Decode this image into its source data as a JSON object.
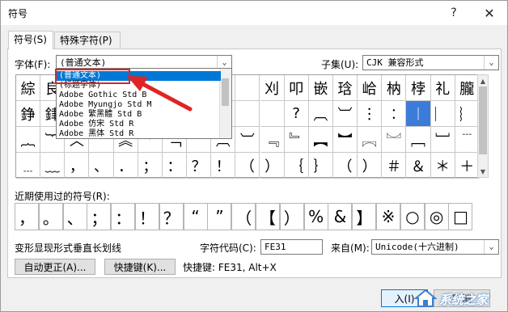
{
  "window": {
    "title": "符号",
    "help": "?",
    "close": "✕"
  },
  "tabs": [
    {
      "label": "符号(S)"
    },
    {
      "label": "特殊字符(P)"
    }
  ],
  "font": {
    "label": "字体(F):",
    "value": "(普通文本)"
  },
  "subset": {
    "label": "子集(U):",
    "value": "CJK 兼容形式"
  },
  "grid": {
    "rows": [
      [
        "綜",
        "良",
        "",
        "",
        "",
        "",
        "",
        "",
        "",
        "",
        "刈",
        "叩",
        "嵌",
        "琀",
        "峆",
        "枘",
        "桲",
        "礼",
        "朧",
        "蘊",
        "蛀",
        "赳",
        "逡"
      ],
      [
        "錚",
        "銉",
        "",
        "",
        "",
        "",
        "",
        "",
        "",
        "",
        "",
        "?",
        "︹",
        "︺",
        "︙",
        "︰",
        "︱",
        "︳",
        "︴",
        "",
        "︵"
      ],
      [
        "︷",
        "︸",
        "︿",
        "﹀",
        "︽",
        "︾",
        "﹁",
        "﹂",
        "︹",
        "︺",
        "﹃",
        "﹄",
        "︻",
        "︼",
        "︗",
        "︘",
        "﹇",
        "﹈",
        "﹉",
        "﹊",
        "﹋",
        "﹌"
      ],
      [
        "﹍",
        "﹏",
        "，",
        "、",
        "．",
        "；",
        "：",
        "？",
        "！",
        "（",
        "）",
        "｛",
        "｝",
        "（",
        "）",
        "＃",
        "＆",
        "＊",
        "＋"
      ]
    ],
    "selected": "︱"
  },
  "dropdown": {
    "items": [
      "(普通文本)",
      "(标题字体)",
      "Adobe Gothic Std B",
      "Adobe Myungjo Std M",
      "Adobe 繁黑體 Std B",
      "Adobe 仿宋 Std R",
      "Adobe 黑体 Std R"
    ],
    "highlighted": "(普通文本)"
  },
  "recent": {
    "label": "近期使用过的符号(R):",
    "symbols": [
      "，",
      "。",
      "、",
      "；",
      "：",
      "！",
      "？",
      "“",
      "”",
      "（",
      "【",
      "）",
      "%",
      "&",
      "】",
      "※",
      "○",
      "◎",
      "□"
    ]
  },
  "char_name": "变形显现形式垂直长划线",
  "char_code": {
    "label": "字符代码(C):",
    "value": "FE31"
  },
  "from": {
    "label": "来自(M):",
    "value": "Unicode(十六进制)"
  },
  "buttons": {
    "autocorrect": "自动更正(A)...",
    "shortcut_key": "快捷键(K)...",
    "shortcut_text": "快捷键: FE31, Alt+X",
    "ok_fragment": "入(I)",
    "cancel_fragment": "取消"
  },
  "watermark": {
    "text": "系统之家"
  },
  "colors": {
    "selected": "#3d7bd9",
    "highlight_red": "#e02424",
    "dropdown_hl": "#0078d7"
  }
}
